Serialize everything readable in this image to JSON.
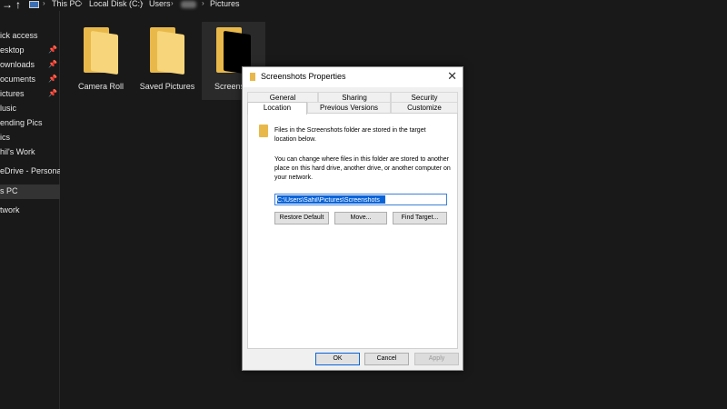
{
  "address_bar": {
    "crumbs": [
      "This PC",
      "Local Disk (C:)",
      "Users",
      "",
      "Pictures"
    ]
  },
  "sidebar": {
    "items": [
      {
        "label": "ick access",
        "pinned": false
      },
      {
        "label": "esktop",
        "pinned": true
      },
      {
        "label": "ownloads",
        "pinned": true
      },
      {
        "label": "ocuments",
        "pinned": true
      },
      {
        "label": "ictures",
        "pinned": true
      },
      {
        "label": "lusic",
        "pinned": false
      },
      {
        "label": "ending Pics",
        "pinned": false
      },
      {
        "label": "ics",
        "pinned": false
      },
      {
        "label": "hil's Work",
        "pinned": false
      },
      {
        "label": "eDrive - Personal",
        "pinned": false
      },
      {
        "label": "s PC",
        "pinned": false,
        "selected": true
      },
      {
        "label": "twork",
        "pinned": false
      }
    ]
  },
  "folders": [
    {
      "label": "Camera Roll"
    },
    {
      "label": "Saved Pictures"
    },
    {
      "label": "Screensh"
    }
  ],
  "dialog": {
    "title": "Screenshots Properties",
    "tabs_top": [
      "General",
      "Sharing",
      "Security"
    ],
    "tabs_bottom": [
      "Location",
      "Previous Versions",
      "Customize"
    ],
    "active_tab": "Location",
    "description1": "Files in the Screenshots folder are stored in the target location below.",
    "description2": "You can change where files in this folder are stored to another place on this hard drive, another drive, or another computer on your network.",
    "path_value": "C:\\Users\\Sahil\\Pictures\\Screenshots",
    "buttons": {
      "restore_default": "Restore Default",
      "move": "Move...",
      "find_target": "Find Target...",
      "ok": "OK",
      "cancel": "Cancel",
      "apply": "Apply"
    }
  },
  "colors": {
    "explorer_bg": "#191919",
    "folder_yellow": "#f7d57a",
    "selection_blue": "#0a64d8"
  }
}
